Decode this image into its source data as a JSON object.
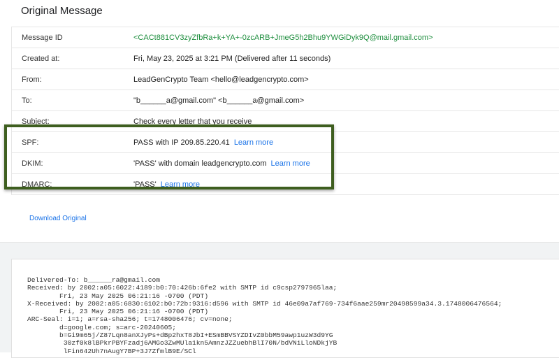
{
  "title": "Original Message",
  "headers": [
    {
      "key": "Message ID",
      "value": "<CACt881CV3zyZfbRa+k+YA+-0zcARB+JmeG5h2Bhu9YWGiDyk9Q@mail.gmail.com>",
      "green": true
    },
    {
      "key": "Created at:",
      "value": "Fri, May 23, 2025 at 3:21 PM (Delivered after 11 seconds)"
    },
    {
      "key": "From:",
      "value": "LeadGenCrypto Team <hello@leadgencrypto.com>"
    },
    {
      "key": "To:",
      "value": "\"b______a@gmail.com\" <b______a@gmail.com>"
    },
    {
      "key": "Subject:",
      "value": "Check every letter that you receive"
    },
    {
      "key": "SPF:",
      "value": "PASS with IP 209.85.220.41",
      "link": "Learn more"
    },
    {
      "key": "DKIM:",
      "value": "'PASS' with domain leadgencrypto.com",
      "link": "Learn more"
    },
    {
      "key": "DMARC:",
      "value": "'PASS'",
      "link": "Learn more"
    }
  ],
  "download_label": "Download Original",
  "raw_lines": [
    "Delivered-To: b______ra@gmail.com",
    "Received: by 2002:a05:6022:4189:b0:70:426b:6fe2 with SMTP id c9csp2797965laa;",
    "        Fri, 23 May 2025 06:21:16 -0700 (PDT)",
    "X-Received: by 2002:a05:6830:6102:b0:72b:9316:d596 with SMTP id 46e09a7af769-734f6aae259mr20498599a34.3.1748006476564;",
    "        Fri, 23 May 2025 06:21:16 -0700 (PDT)",
    "ARC-Seal: i=1; a=rsa-sha256; t=1748006476; cv=none;",
    "        d=google.com; s=arc-20240605;",
    "        b=Gi9m65j/Z87Lqn8anXJyPs+dBp2hxT8JbI+ESmBBVSYZDIvZ0bbM59awp1uzW3d9YG",
    "         30zf0k8lBPkrPBYFzadj6AMGo3ZwMUla1kn5AmnzJZZuebhBlI70N/bdVNiLloNDkjYB",
    "         lFin642Uh7nAugY7BP+3J7ZfmlB9E/SCl"
  ]
}
